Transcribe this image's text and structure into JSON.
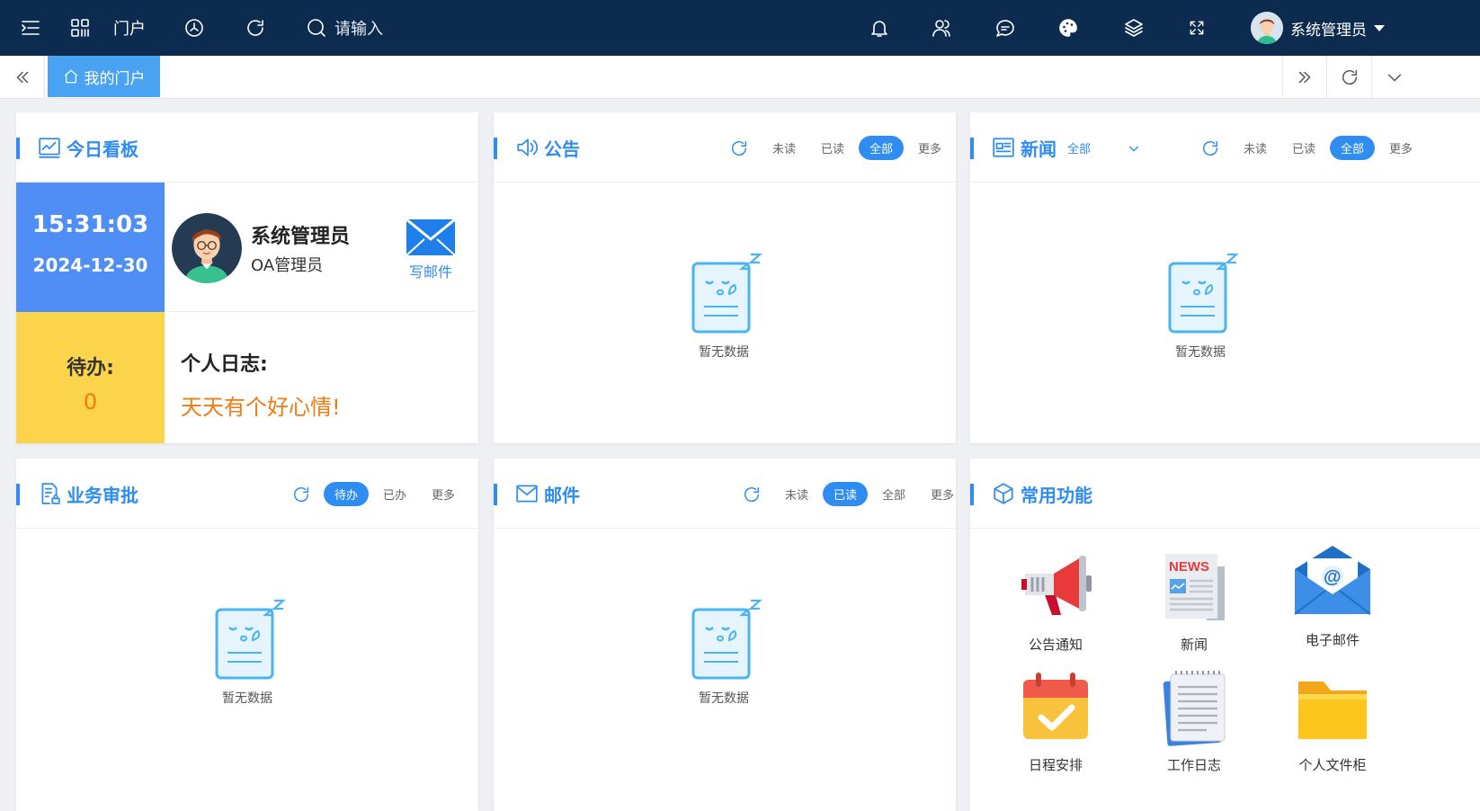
{
  "topbar": {
    "menu_label": "门户",
    "search_placeholder": "请输入",
    "user_name": "系统管理员"
  },
  "tabs": {
    "active_label": "我的门户"
  },
  "today": {
    "title": "今日看板",
    "time": "15:31:03",
    "date": "2024-12-30",
    "user_name": "系统管理员",
    "user_role": "OA管理员",
    "write_mail": "写邮件",
    "todo_label": "待办:",
    "todo_count": "0",
    "journal_label": "个人日志:",
    "journal_text": "天天有个好心情!"
  },
  "notice": {
    "title": "公告",
    "filters": [
      "未读",
      "已读",
      "全部",
      "更多"
    ],
    "active_filter": "全部",
    "empty": "暂无数据"
  },
  "news": {
    "title": "新闻",
    "category": "全部",
    "filters": [
      "未读",
      "已读",
      "全部",
      "更多"
    ],
    "active_filter": "全部",
    "empty": "暂无数据"
  },
  "approval": {
    "title": "业务审批",
    "filters": [
      "待办",
      "已办",
      "更多"
    ],
    "active_filter": "待办",
    "empty": "暂无数据"
  },
  "mail": {
    "title": "邮件",
    "filters": [
      "未读",
      "已读",
      "全部",
      "更多"
    ],
    "active_filter": "已读",
    "empty": "暂无数据"
  },
  "functions": {
    "title": "常用功能",
    "items": [
      {
        "label": "公告通知",
        "icon": "megaphone-icon"
      },
      {
        "label": "新闻",
        "icon": "newspaper-icon"
      },
      {
        "label": "电子邮件",
        "icon": "email-icon"
      },
      {
        "label": "日程安排",
        "icon": "calendar-icon"
      },
      {
        "label": "工作日志",
        "icon": "notepad-icon"
      },
      {
        "label": "个人文件柜",
        "icon": "folder-icon"
      }
    ]
  },
  "colors": {
    "topbar": "#0c2b4e",
    "accent": "#2f8cf0",
    "time_panel": "#4f8ef4",
    "todo_panel": "#fbd44c",
    "highlight_text": "#f07b12"
  }
}
